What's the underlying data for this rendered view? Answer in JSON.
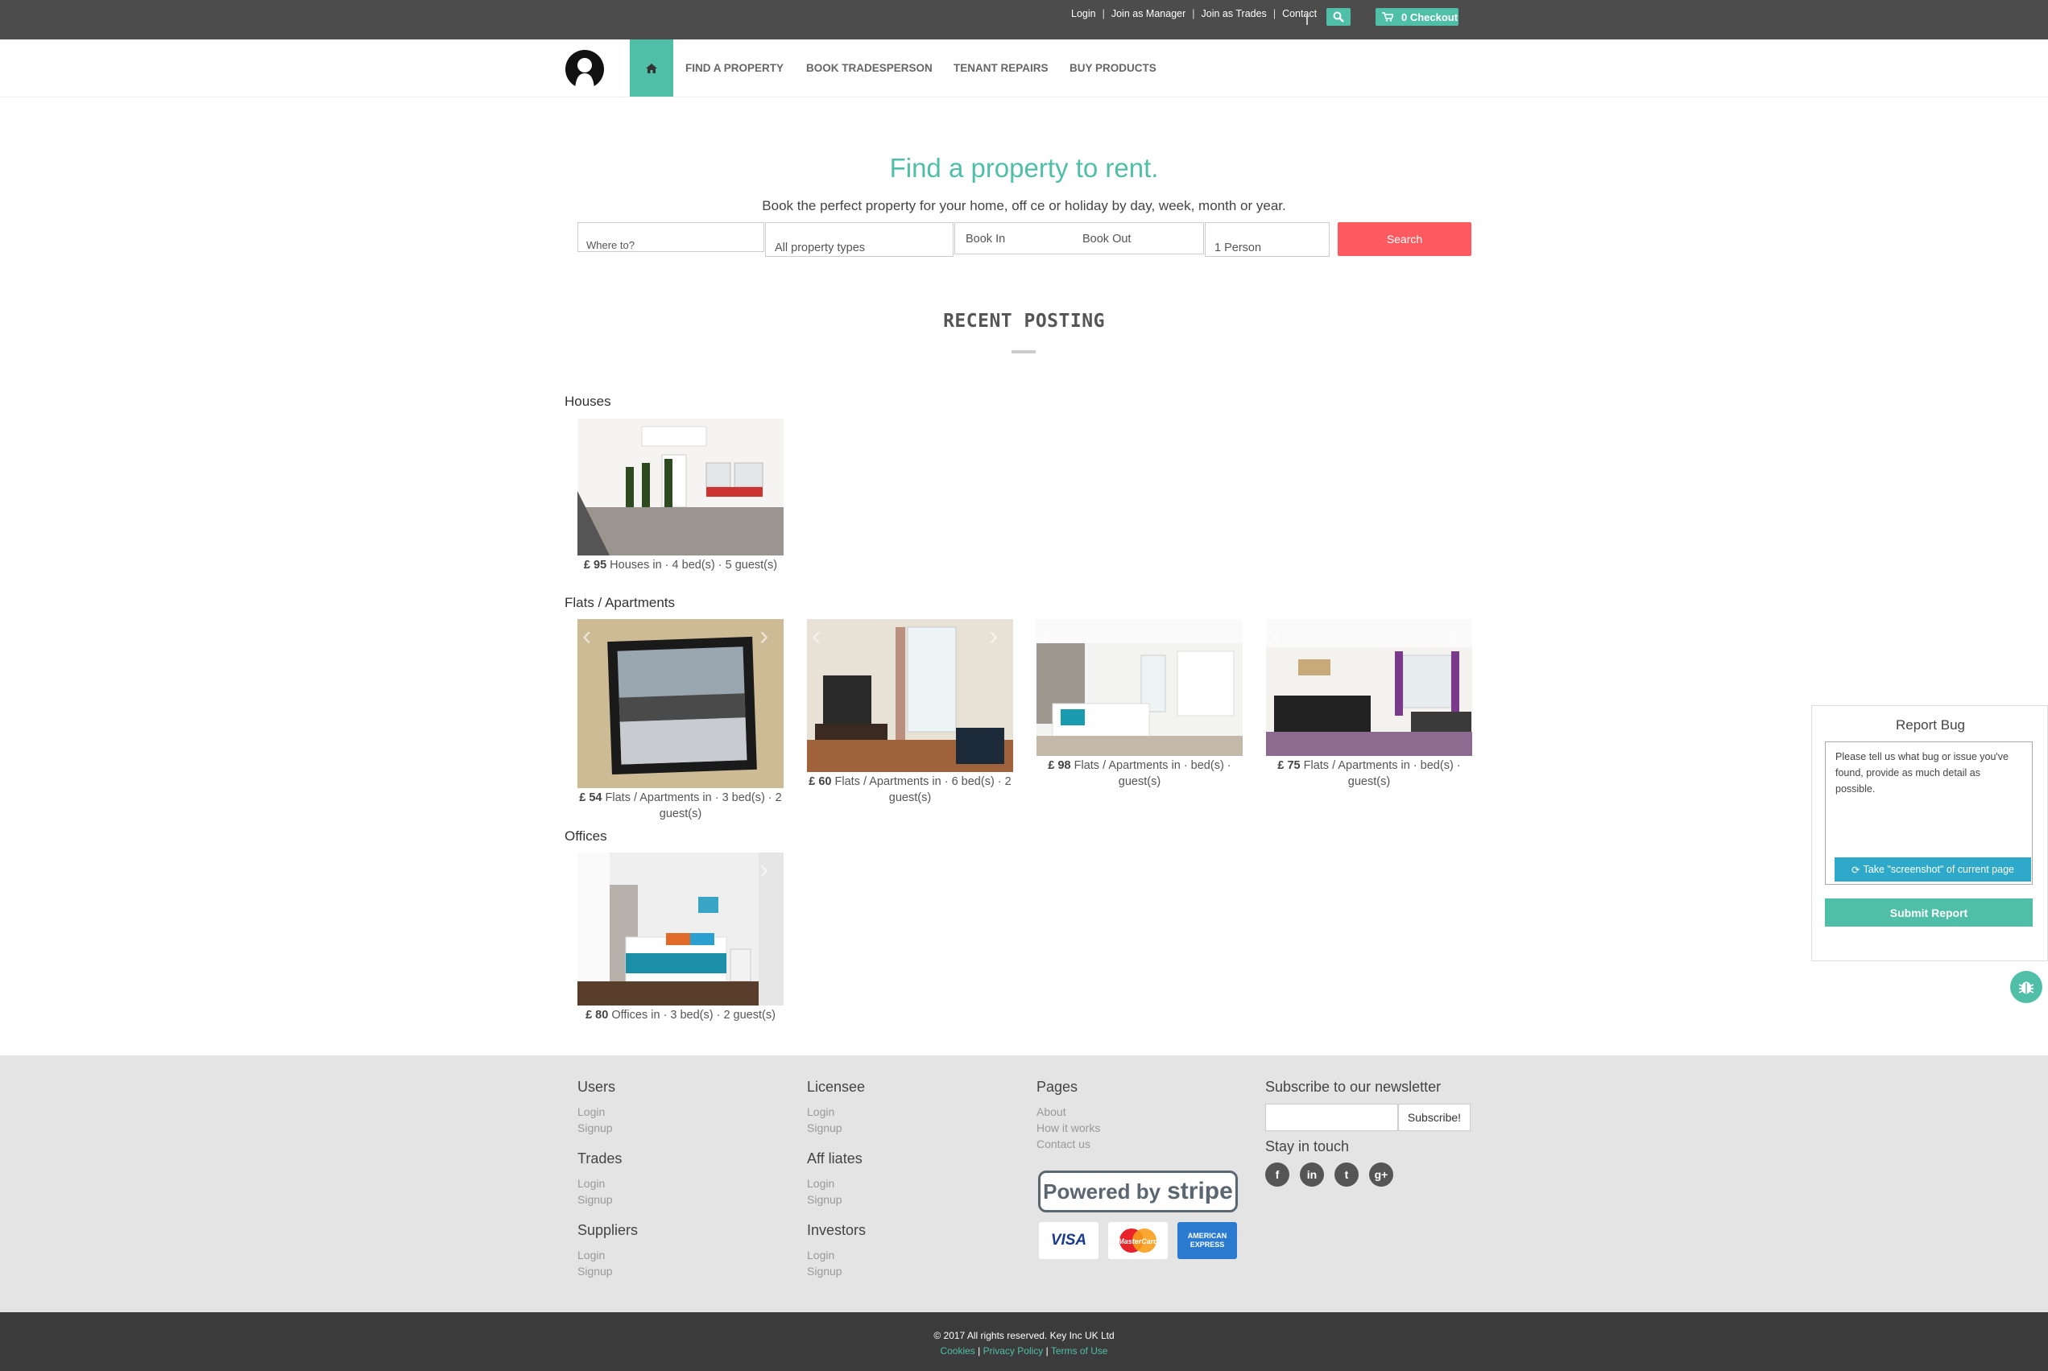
{
  "topbar": {
    "links": [
      "Login",
      "Join as Manager",
      "Join as Trades",
      "Contact"
    ],
    "checkout_label": "0 Checkout"
  },
  "nav": {
    "items": [
      "FIND A PROPERTY",
      "BOOK TRADESPERSON",
      "TENANT REPAIRS",
      "BUY PRODUCTS"
    ]
  },
  "hero": {
    "title": "Find a property to rent.",
    "subtitle": "Book the perfect property for your home, off ce or holiday by day, week, month or year."
  },
  "search": {
    "where_placeholder": "Where to?",
    "property_type": "All property types",
    "book_in": "Book In",
    "book_out": "Book Out",
    "guests": "1 Person",
    "button": "Search"
  },
  "recent": {
    "title": "RECENT POSTING",
    "categories": [
      {
        "name": "Houses",
        "listings": [
          {
            "price": "£ 95",
            "text": "Houses in · 4 bed(s) · 5 guest(s)"
          }
        ]
      },
      {
        "name": "Flats / Apartments",
        "listings": [
          {
            "price": "£ 54",
            "text": "Flats / Apartments in · 3 bed(s) · 2 guest(s)"
          },
          {
            "price": "£ 60",
            "text": "Flats / Apartments in · 6 bed(s) · 2 guest(s)"
          },
          {
            "price": "£ 98",
            "text": "Flats / Apartments in · bed(s) · guest(s)"
          },
          {
            "price": "£ 75",
            "text": "Flats / Apartments in · bed(s) · guest(s)"
          }
        ]
      },
      {
        "name": "Offices",
        "listings": [
          {
            "price": "£ 80",
            "text": "Offices in · 3 bed(s) · 2 guest(s)"
          }
        ]
      }
    ]
  },
  "bug_report": {
    "title": "Report Bug",
    "placeholder": "Please tell us what bug or issue you've found, provide as much detail as possible.",
    "screenshot_button": "Take \"screenshot\" of current page",
    "submit": "Submit Report"
  },
  "footer": {
    "columns": [
      {
        "title": "Users",
        "links": [
          "Login",
          "Signup"
        ]
      },
      {
        "title": "Trades",
        "links": [
          "Login",
          "Signup"
        ]
      },
      {
        "title": "Suppliers",
        "links": [
          "Login",
          "Signup"
        ]
      },
      {
        "title": "Licensee",
        "links": [
          "Login",
          "Signup"
        ]
      },
      {
        "title": "Aff liates",
        "links": [
          "Login",
          "Signup"
        ]
      },
      {
        "title": "Investors",
        "links": [
          "Login",
          "Signup"
        ]
      },
      {
        "title": "Pages",
        "links": [
          "About",
          "How it works",
          "Contact us"
        ]
      }
    ],
    "newsletter_title": "Subscribe to our newsletter",
    "subscribe_button": "Subscribe!",
    "stay_in_touch": "Stay in touch",
    "stripe_text": "Powered by",
    "stripe_brand": "stripe",
    "cards": [
      "VISA",
      "MasterCard",
      "AMERICAN EXPRESS"
    ],
    "copyright": "© 2017 All rights reserved. Key Inc UK Ltd",
    "legal_links": [
      "Cookies",
      "Privacy Policy",
      "Terms of Use"
    ]
  },
  "colors": {
    "accent": "#4fbfa8",
    "search_button": "#fe5a5f",
    "topbar": "#4c4c4c",
    "footer": "#e4e4e4",
    "copybar": "#3b3b3b"
  }
}
